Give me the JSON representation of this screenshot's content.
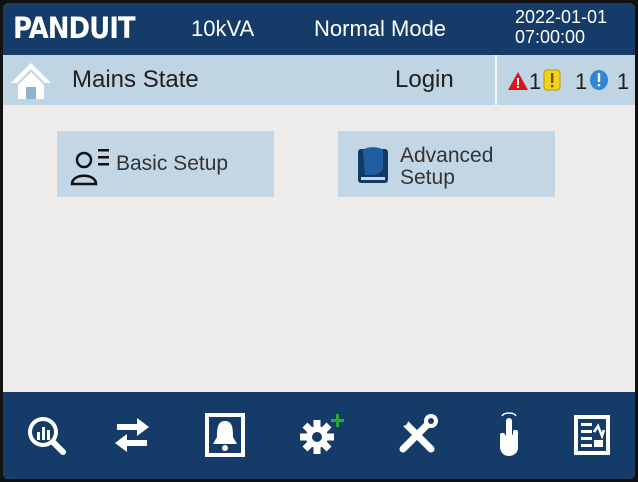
{
  "header": {
    "brand": "PANDUIT",
    "capacity": "10kVA",
    "mode": "Normal Mode",
    "date": "2022-01-01",
    "time": "07:00:00"
  },
  "statebar": {
    "title": "Mains State",
    "login_label": "Login",
    "alarms": [
      {
        "icon": "critical-alarm-icon",
        "count": "1",
        "color": "#d9141b"
      },
      {
        "icon": "warning-alarm-icon",
        "count": "1",
        "color": "#f2d21a"
      },
      {
        "icon": "info-alarm-icon",
        "count": "1",
        "color": "#2f86d6"
      }
    ]
  },
  "main": {
    "buttons": [
      {
        "icon": "user-settings-icon",
        "label_lines": [
          "Basic Setup"
        ]
      },
      {
        "icon": "advanced-setup-icon",
        "label_lines": [
          "Advanced",
          "Setup"
        ]
      }
    ]
  },
  "nav": {
    "icons": [
      "data-analysis-icon",
      "transfer-icon",
      "alarm-bell-icon",
      "settings-plus-icon",
      "tools-icon",
      "touch-control-icon",
      "log-record-icon"
    ]
  },
  "colors": {
    "header_bg": "#153b69",
    "state_bg": "#c0d5e4",
    "button_bg": "#c2d6e5",
    "screen_bg": "#eeecea",
    "plus_accent": "#29a83a"
  }
}
